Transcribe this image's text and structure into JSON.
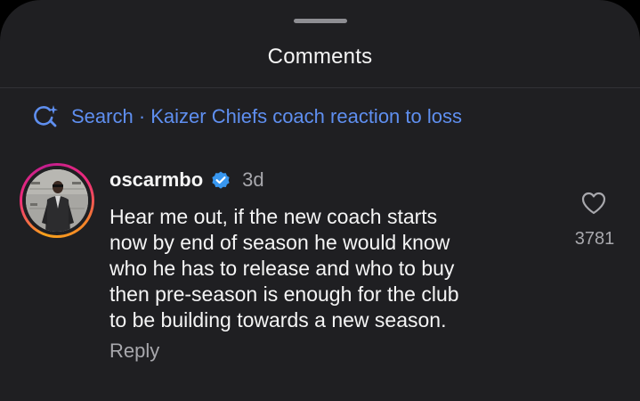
{
  "header": {
    "title": "Comments"
  },
  "search": {
    "icon": "search-sparkle-icon",
    "text": "Search · Kaizer Chiefs coach reaction to loss",
    "color": "#5f8ff0"
  },
  "comment": {
    "username": "oscarmbo",
    "verified": true,
    "timestamp": "3d",
    "text": "Hear me out, if the new coach starts\nnow by end of season he would know\nwho he has to release and who to buy\nthen pre-season is enough for the club\nto be building towards a new season.",
    "reply_label": "Reply",
    "likes": "3781",
    "like_icon": "heart-outline-icon",
    "verified_color": "#3897f0"
  },
  "colors": {
    "sheet_background": "#1f1f22",
    "story_ring": "#ee2a7b",
    "secondary_text": "#a8a8ad"
  }
}
